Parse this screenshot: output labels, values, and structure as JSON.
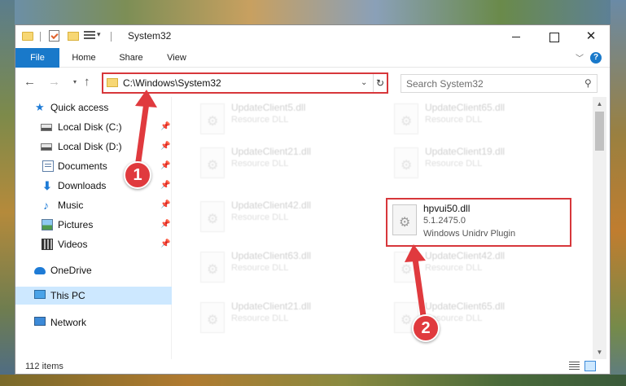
{
  "window": {
    "title": "System32"
  },
  "ribbon": {
    "tabs": [
      {
        "label": "File"
      },
      {
        "label": "Home"
      },
      {
        "label": "Share"
      },
      {
        "label": "View"
      }
    ],
    "help_label": "?"
  },
  "navigation": {
    "address": "C:\\Windows\\System32",
    "search_placeholder": "Search System32"
  },
  "sidebar": {
    "items": [
      {
        "label": "Quick access",
        "icon": "star-icon"
      },
      {
        "label": "Local Disk (C:)",
        "icon": "disk-icon",
        "pinned": true
      },
      {
        "label": "Local Disk (D:)",
        "icon": "disk-icon",
        "pinned": true
      },
      {
        "label": "Documents",
        "icon": "documents-icon",
        "pinned": true
      },
      {
        "label": "Downloads",
        "icon": "download-icon",
        "pinned": true
      },
      {
        "label": "Music",
        "icon": "music-icon",
        "pinned": true
      },
      {
        "label": "Pictures",
        "icon": "pictures-icon",
        "pinned": true
      },
      {
        "label": "Videos",
        "icon": "videos-icon",
        "pinned": true
      },
      {
        "label": "OneDrive",
        "icon": "onedrive-icon"
      },
      {
        "label": "This PC",
        "icon": "computer-icon",
        "selected": true
      },
      {
        "label": "Network",
        "icon": "network-icon"
      }
    ]
  },
  "files": [
    {
      "name": "UpdateClient5.dll",
      "type": "Resource DLL"
    },
    {
      "name": "UpdateClient65.dll",
      "type": "Resource DLL"
    },
    {
      "name": "UpdateClient21.dll",
      "type": "Resource DLL"
    },
    {
      "name": "UpdateClient19.dll",
      "type": "Resource DLL"
    },
    {
      "name": "UpdateClient42.dll",
      "type": "Resource DLL"
    },
    {
      "name": "hpvui50.dll",
      "version": "5.1.2475.0",
      "type": "Windows Unidrv Plugin",
      "highlighted": true
    },
    {
      "name": "UpdateClient63.dll",
      "type": "Resource DLL"
    },
    {
      "name": "UpdateClient42.dll",
      "type": "Resource DLL"
    },
    {
      "name": "UpdateClient21.dll",
      "type": "Resource DLL"
    },
    {
      "name": "UpdateClient65.dll",
      "type": "Resource DLL"
    }
  ],
  "status": {
    "item_count": "112 items"
  },
  "annotations": {
    "step1": "1",
    "step2": "2"
  },
  "colors": {
    "accent": "#1979ca",
    "highlight": "#d7373b",
    "selected": "#cde8ff"
  }
}
